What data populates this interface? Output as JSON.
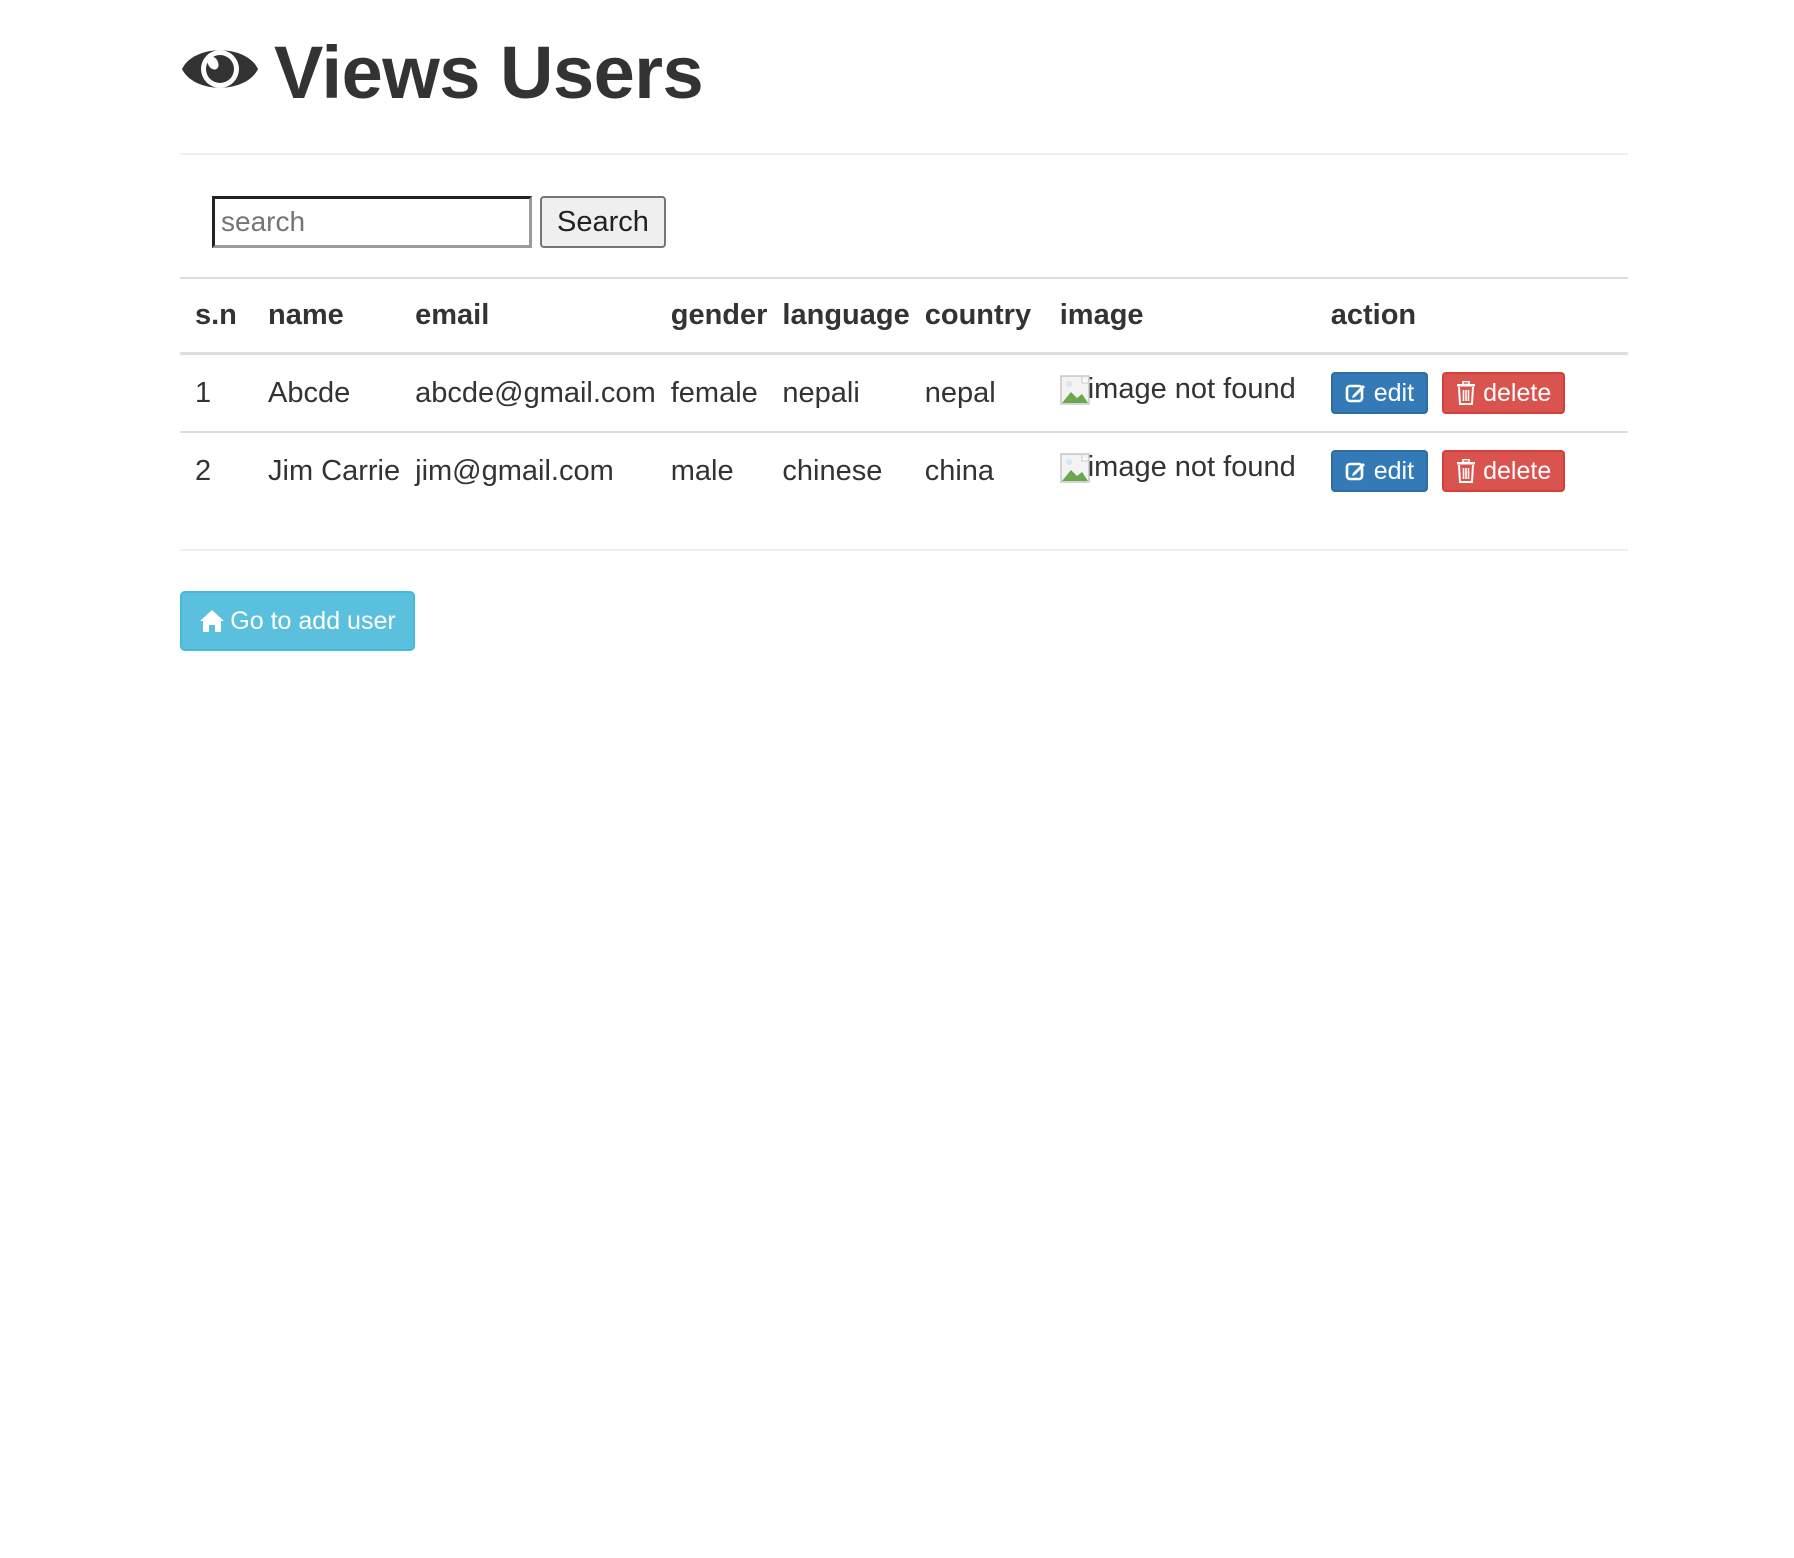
{
  "header": {
    "icon": "eye-icon",
    "title": "Views Users"
  },
  "search": {
    "placeholder": "search",
    "value": "",
    "button_label": "Search",
    "icon_none": ""
  },
  "table": {
    "columns": [
      "s.n",
      "name",
      "email",
      "gender",
      "language",
      "country",
      "image",
      "action"
    ],
    "rows": [
      {
        "sn": "1",
        "name": "Abcde",
        "email": "abcde@gmail.com",
        "gender": "female",
        "language": "nepali",
        "country": "nepal",
        "image_alt": "image not found",
        "edit_label": "edit",
        "delete_label": "delete"
      },
      {
        "sn": "2",
        "name": "Jim Carrie",
        "email": "jim@gmail.com",
        "gender": "male",
        "language": "chinese",
        "country": "china",
        "image_alt": "image not found",
        "edit_label": "edit",
        "delete_label": "delete"
      }
    ]
  },
  "footer": {
    "add_user_label": "Go to add user",
    "add_user_icon": "home-icon"
  },
  "colors": {
    "edit": "#337ab7",
    "delete": "#d9534f",
    "info": "#5bc0de",
    "text": "#333333"
  }
}
